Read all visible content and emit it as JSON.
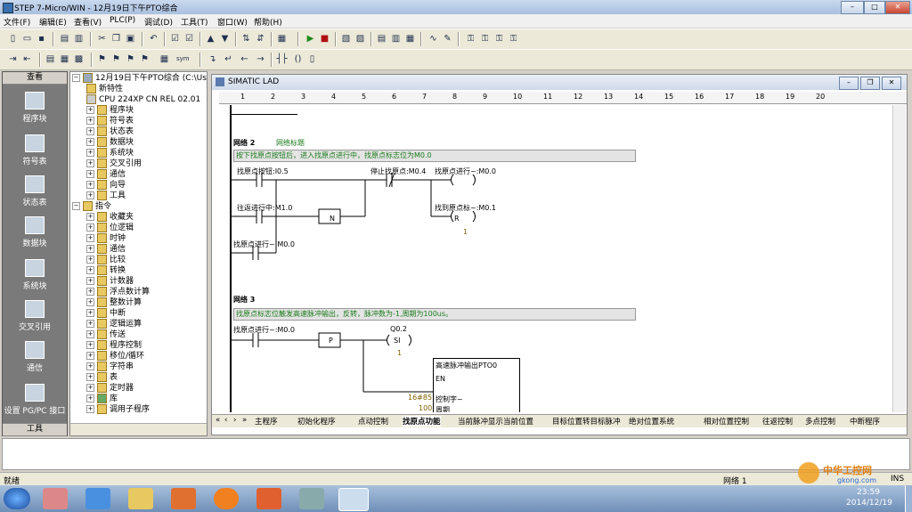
{
  "window": {
    "title": "STEP 7-Micro/WIN - 12月19日下午PTO综合"
  },
  "menu": [
    "文件(F)",
    "编辑(E)",
    "查看(V)",
    "PLC(P)",
    "调试(D)",
    "工具(T)",
    "窗口(W)",
    "帮助(H)"
  ],
  "nav": {
    "header": "查看",
    "footer": "工具",
    "items": [
      "程序块",
      "符号表",
      "状态表",
      "数据块",
      "系统块",
      "交叉引用",
      "通信",
      "设置 PG/PC 接口"
    ]
  },
  "tree": {
    "project": "12月19日下午PTO综合 (C:\\User",
    "items": [
      "新特性",
      "CPU 224XP CN REL 02.01",
      "程序块",
      "符号表",
      "状态表",
      "数据块",
      "系统块",
      "交叉引用",
      "通信",
      "向导",
      "工具"
    ],
    "instructions_label": "指令",
    "instructions": [
      "收藏夹",
      "位逻辑",
      "时钟",
      "通信",
      "比较",
      "转换",
      "计数器",
      "浮点数计算",
      "整数计算",
      "中断",
      "逻辑运算",
      "传送",
      "程序控制",
      "移位/循环",
      "字符串",
      "表",
      "定时器",
      "库",
      "调用子程序"
    ]
  },
  "editor": {
    "title": "SIMATIC LAD",
    "ruler": [
      "1",
      "2",
      "3",
      "4",
      "5",
      "6",
      "7",
      "8",
      "9",
      "10",
      "11",
      "12",
      "13",
      "14",
      "15",
      "16",
      "17",
      "18",
      "19",
      "20"
    ]
  },
  "network2": {
    "label": "网络 2",
    "title": "网络标题",
    "comment": "按下找原点按钮后，进入找原点进行中，找原点标志位为M0.0",
    "c1": "找原点按钮:I0.5",
    "c2": "停止找原点:M0.4",
    "c3": "往返进行中:M1.0",
    "c3_box": "N",
    "c4": "找原点进行~:M0.0",
    "coil1": "找原点进行~:M0.0",
    "coil2": "找到原点标~:M0.1",
    "coil2_letter": "R",
    "coil2_n": "1"
  },
  "network3": {
    "label": "网络 3",
    "comment": "找原点标志位触发高速脉冲输出，反转，脉冲数为-1,周期为100us。",
    "c1": "找原点进行~:M0.0",
    "c1_box": "P",
    "coil": "Q0.2",
    "coil_letter": "SI",
    "coil_n": "1",
    "box_title": "高速脉冲输出PTO0",
    "box_en": "EN",
    "in_val": "16#85",
    "in_name": "控制字~",
    "in_val2": "100",
    "in_name2": "周期"
  },
  "tabs": [
    "主程序",
    "初始化程序",
    "点动控制",
    "找原点功能",
    "当前脉冲显示当前位置",
    "目标位置转目标脉冲",
    "绝对位置系统",
    "相对位置控制",
    "往返控制",
    "多点控制",
    "中断程序"
  ],
  "status": {
    "left": "就绪",
    "network": "网络 1",
    "ins": "INS"
  },
  "taskbar": {
    "time": "23:59",
    "date": "2014/12/19"
  },
  "watermark": {
    "cn": "中华工控网",
    "url": "gkong.com"
  }
}
